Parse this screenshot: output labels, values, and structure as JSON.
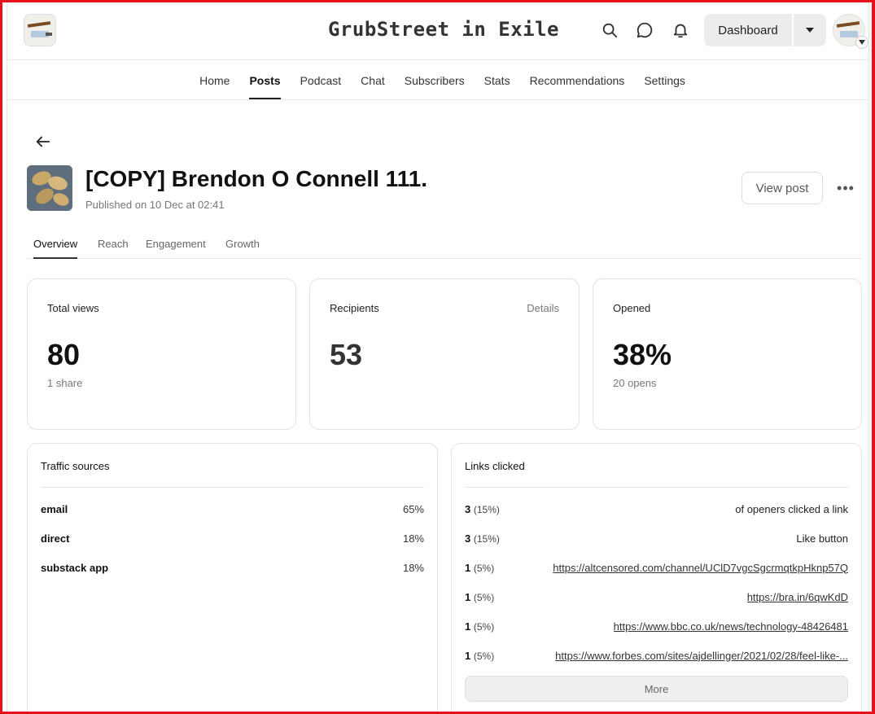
{
  "header": {
    "site_title": "GrubStreet in Exile",
    "dashboard_label": "Dashboard"
  },
  "nav": {
    "items": [
      {
        "label": "Home",
        "active": false
      },
      {
        "label": "Posts",
        "active": true
      },
      {
        "label": "Podcast",
        "active": false
      },
      {
        "label": "Chat",
        "active": false
      },
      {
        "label": "Subscribers",
        "active": false
      },
      {
        "label": "Stats",
        "active": false
      },
      {
        "label": "Recommendations",
        "active": false
      },
      {
        "label": "Settings",
        "active": false
      }
    ]
  },
  "post": {
    "title": "[COPY] Brendon O Connell 111.",
    "published": "Published on 10 Dec at 02:41",
    "view_post_label": "View post"
  },
  "tabs": [
    "Overview",
    "Reach",
    "Engagement",
    "Growth"
  ],
  "stats": {
    "total_views": {
      "label": "Total views",
      "value": "80",
      "sub": "1 share"
    },
    "recipients": {
      "label": "Recipients",
      "value": "53",
      "details": "Details"
    },
    "opened": {
      "label": "Opened",
      "value": "38%",
      "sub": "20 opens"
    }
  },
  "traffic": {
    "title": "Traffic sources",
    "rows": [
      {
        "source": "email",
        "pct": "65%"
      },
      {
        "source": "direct",
        "pct": "18%"
      },
      {
        "source": "substack app",
        "pct": "18%"
      }
    ]
  },
  "links": {
    "title": "Links clicked",
    "rows": [
      {
        "count": "3",
        "pct": "(15%)",
        "target": "of openers clicked a link",
        "is_link": false
      },
      {
        "count": "3",
        "pct": "(15%)",
        "target": "Like button",
        "is_link": false
      },
      {
        "count": "1",
        "pct": "(5%)",
        "target": "https://altcensored.com/channel/UClD7vgcSgcrmqtkpHknp57Q",
        "is_link": true
      },
      {
        "count": "1",
        "pct": "(5%)",
        "target": "https://bra.in/6qwKdD",
        "is_link": true
      },
      {
        "count": "1",
        "pct": "(5%)",
        "target": "https://www.bbc.co.uk/news/technology-48426481",
        "is_link": true
      },
      {
        "count": "1",
        "pct": "(5%)",
        "target": "https://www.forbes.com/sites/ajdellinger/2021/02/28/feel-like-...",
        "is_link": true
      }
    ],
    "more_label": "More"
  },
  "colors": {
    "frame": "#e8101a",
    "text": "#111111",
    "muted": "#777777",
    "border": "#e3e3e3"
  }
}
